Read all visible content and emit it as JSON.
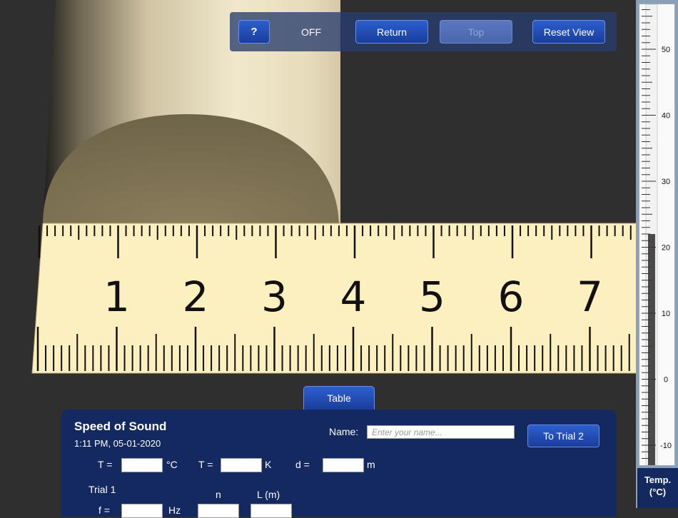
{
  "toolbar": {
    "help_label": "?",
    "sound_state": "OFF",
    "return_label": "Return",
    "top_label": "Top",
    "reset_label": "Reset View"
  },
  "ruler": {
    "numbers": [
      "1",
      "2",
      "3",
      "4",
      "5",
      "6",
      "7"
    ]
  },
  "thermometer": {
    "scale_labels": [
      "50",
      "40",
      "30",
      "20",
      "10",
      "0",
      "-10"
    ],
    "label_line1": "Temp.",
    "label_line2": "(°C)",
    "reading_celsius": 22
  },
  "table_tab": {
    "label": "Table"
  },
  "panel": {
    "title": "Speed of Sound",
    "datetime": "1:11 PM, 05-01-2020",
    "name_label": "Name:",
    "name_placeholder": "Enter your name...",
    "trial2_label": "To Trial 2",
    "t_label_1": "T =",
    "t_unit_1": "°C",
    "t_label_2": "T =",
    "t_unit_2": "K",
    "d_label": "d =",
    "d_unit": "m",
    "trial_label": "Trial 1",
    "n_header": "n",
    "l_header": "L (m)",
    "f_label": "f =",
    "f_unit": "Hz"
  },
  "colors": {
    "panel_bg": "#14295f",
    "button_blue": "#1f4bb5",
    "ruler_cream": "#fcefc0",
    "tube_cream": "#e8dcbd"
  }
}
